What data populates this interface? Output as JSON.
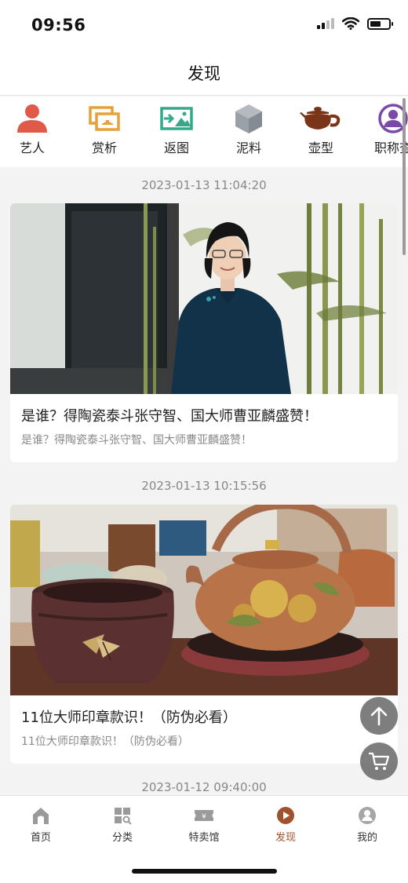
{
  "status_bar": {
    "time": "09:56"
  },
  "nav": {
    "title": "发现"
  },
  "categories": [
    {
      "label": "艺人",
      "icon": "person-icon"
    },
    {
      "label": "赏析",
      "icon": "gallery-icon"
    },
    {
      "label": "返图",
      "icon": "photo-return-icon"
    },
    {
      "label": "泥料",
      "icon": "cube-icon"
    },
    {
      "label": "壶型",
      "icon": "teapot-icon"
    },
    {
      "label": "职称查",
      "icon": "user-circle-icon"
    }
  ],
  "feed": [
    {
      "timestamp": "2023-01-13 11:04:20",
      "title": "是谁？得陶瓷泰斗张守智、国大师曹亚麟盛赞！",
      "summary": "是谁？得陶瓷泰斗张守智、国大师曹亚麟盛赞！"
    },
    {
      "timestamp": "2023-01-13 10:15:56",
      "title": "11位大师印章款识！（防伪必看）",
      "summary": "11位大师印章款识！（防伪必看）"
    },
    {
      "timestamp": "2023-01-12 09:40:00"
    }
  ],
  "floating": {
    "top_icon": "arrow-up-icon",
    "cart_icon": "cart-icon"
  },
  "tabs": [
    {
      "label": "首页",
      "icon": "home-icon"
    },
    {
      "label": "分类",
      "icon": "grid-icon"
    },
    {
      "label": "特卖馆",
      "icon": "ticket-icon"
    },
    {
      "label": "发现",
      "icon": "play-circle-icon",
      "active": true
    },
    {
      "label": "我的",
      "icon": "profile-icon"
    }
  ],
  "colors": {
    "accent": "#a0522d",
    "person": "#e05a4a",
    "gallery": "#e8a03a",
    "photo": "#35a88a",
    "cube": "#9aa0a8",
    "teapot": "#7a3518",
    "user": "#7a4aa8"
  }
}
